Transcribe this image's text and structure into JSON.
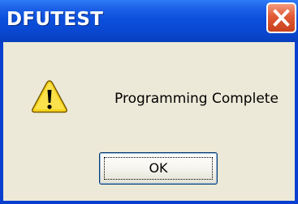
{
  "window": {
    "title": "DFUTEST"
  },
  "dialog": {
    "icon": "warning-icon",
    "message": "Programming Complete",
    "ok_label": "OK"
  },
  "colors": {
    "titlebar": "#0a47d0",
    "client_background": "#ece9d8",
    "close_button": "#e05a36",
    "warning_yellow": "#f7d51d"
  }
}
